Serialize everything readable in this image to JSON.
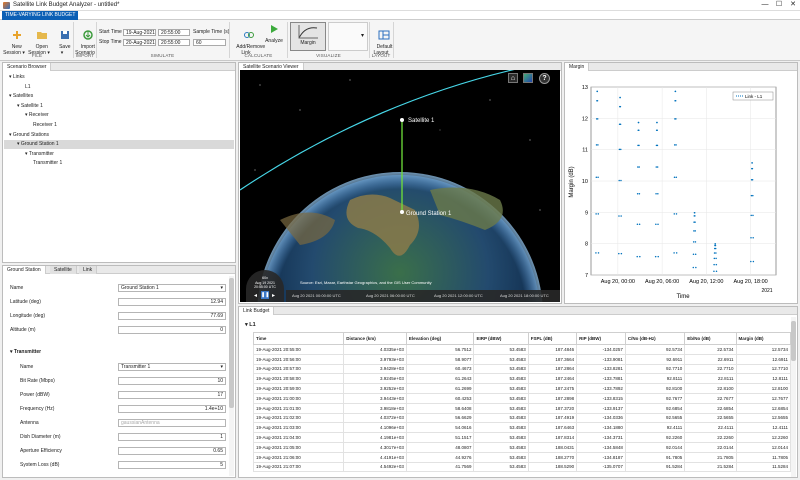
{
  "window": {
    "title": "Satellite Link Budget Analyzer - untitled*",
    "min": "—",
    "max": "☐",
    "close": "✕"
  },
  "toolstrip_tab": "TIME-VARYING LINK BUDGET",
  "toolbar": {
    "new_session": "New\nSession ▾",
    "open_session": "Open\nSession ▾",
    "save": "Save\n▾",
    "import": "Import\nScenario",
    "start_time_label": "Start Time",
    "start_date": "19-Aug-2021",
    "start_clock": "20:55:00",
    "stop_time_label": "Stop Time",
    "stop_date": "20-Aug-2021",
    "stop_clock": "20:55:00",
    "sample_time_label": "Sample Time (s)",
    "sample_time": "60",
    "add_remove_link": "Add/Remove\nLink",
    "analyze": "Analyze",
    "visualize_margin": "Margin",
    "default_layout": "Default\nLayout",
    "sections": {
      "file": "FILE",
      "import": "IMPORT",
      "simulate": "SIMULATE",
      "calculate": "CALCULATE",
      "visualize": "VISUALIZE",
      "layout": "LAYOUT"
    }
  },
  "scenario_browser": {
    "title": "Scenario Browser",
    "tree": [
      {
        "label": "Links",
        "indent": 0,
        "arrow": "▾"
      },
      {
        "label": "L1",
        "indent": 2,
        "arrow": ""
      },
      {
        "label": "Satellites",
        "indent": 0,
        "arrow": "▾"
      },
      {
        "label": "Satellite 1",
        "indent": 1,
        "arrow": "▾"
      },
      {
        "label": "Receiver",
        "indent": 2,
        "arrow": "▾"
      },
      {
        "label": "Receiver 1",
        "indent": 3,
        "arrow": ""
      },
      {
        "label": "Ground Stations",
        "indent": 0,
        "arrow": "▾"
      },
      {
        "label": "Ground Station 1",
        "indent": 1,
        "arrow": "▾",
        "selected": true
      },
      {
        "label": "Transmitter",
        "indent": 2,
        "arrow": "▾"
      },
      {
        "label": "Transmitter 1",
        "indent": 3,
        "arrow": ""
      }
    ]
  },
  "props": {
    "tabs": [
      "Ground Station",
      "Satellite",
      "Link"
    ],
    "name_label": "Name",
    "name_value": "Ground Station 1",
    "lat_label": "Latitude (deg)",
    "lat_value": "12.94",
    "lon_label": "Longitude (deg)",
    "lon_value": "77.69",
    "alt_label": "Altitude (m)",
    "alt_value": "0",
    "tx_header": "▾ Transmitter",
    "tx_name_label": "Name",
    "tx_name_value": "Transmitter 1",
    "bitrate_label": "Bit Rate (Mbps)",
    "bitrate_value": "10",
    "power_label": "Power (dBW)",
    "power_value": "17",
    "freq_label": "Frequency (Hz)",
    "freq_value": "1.4e+10",
    "antenna_label": "Antenna",
    "antenna_placeholder": "gaussianAntenna",
    "dish_label": "Dish Diameter (m)",
    "dish_value": "1",
    "eff_label": "Aperture Efficiency",
    "eff_value": "0.65",
    "loss_label": "System Loss (dB)",
    "loss_value": "5"
  },
  "viewer": {
    "title": "Satellite Scenario Viewer",
    "satellite_label": "Satellite 1",
    "ground_label": "Ground Station 1",
    "attribution": "Source: Esri, Maxar, Earthstar Geographics, and the GIS User Community",
    "timeline": [
      "Aug 20 2021 00:00:00 UTC",
      "Aug 20 2021 06:00:00 UTC",
      "Aug 20 2021 12:00:00 UTC",
      "Aug 20 2021 18:00:00 UTC"
    ],
    "clock_date": "Aug 19 2021",
    "clock_time": "20:55:00 UTC",
    "speed": "60x"
  },
  "margin_panel": {
    "title": "Margin"
  },
  "chart_data": {
    "type": "scatter",
    "ylabel": "Margin (dB)",
    "xlabel": "Time",
    "ylim": [
      7,
      13
    ],
    "yticks": [
      "13",
      "12",
      "11",
      "10",
      "9",
      "8",
      "7"
    ],
    "xticks": [
      "Aug 20, 00:00",
      "Aug 20, 06:00",
      "Aug 20, 12:00",
      "Aug 20, 18:00"
    ],
    "xyear": "2021",
    "legend": "Link - L1",
    "legend_position": "top-right",
    "color": "#0072bd",
    "passes": [
      {
        "t": 0.2,
        "peak": 12.9
      },
      {
        "t": 3.3,
        "peak": 12.7
      },
      {
        "t": 5.8,
        "peak": 11.9
      },
      {
        "t": 8.3,
        "peak": 11.9
      },
      {
        "t": 10.8,
        "peak": 12.9
      },
      {
        "t": 13.4,
        "peak": 9.0
      },
      {
        "t": 16.2,
        "peak": 8.0
      },
      {
        "t": 21.2,
        "peak": 10.6
      }
    ]
  },
  "link_budget": {
    "title": "Link Budget",
    "section": "▾ L1",
    "columns": [
      "Time",
      "Distance (km)",
      "Elevation (deg)",
      "EIRP (dBW)",
      "FSPL (dB)",
      "RIP (dBW)",
      "C/No (dB-Hz)",
      "Eb/No (dB)",
      "Margin (dB)"
    ],
    "rows": [
      [
        "19-Aug-2021 20:55:00",
        "4.0335e+03",
        "56.7512",
        "53.4583",
        "187.4846",
        "-134.0257",
        "92.5734",
        "22.5734",
        "12.5734"
      ],
      [
        "19-Aug-2021 20:56:00",
        "3.9793e+03",
        "58.9077",
        "53.4583",
        "187.3664",
        "-133.9081",
        "92.6911",
        "22.6911",
        "12.6911"
      ],
      [
        "19-Aug-2021 20:57:00",
        "3.9428e+03",
        "60.4673",
        "53.4583",
        "187.2864",
        "-133.8281",
        "92.7710",
        "22.7710",
        "12.7710"
      ],
      [
        "19-Aug-2021 20:58:00",
        "3.9245e+03",
        "61.2643",
        "53.4583",
        "187.2464",
        "-133.7881",
        "92.8111",
        "22.8111",
        "12.8111"
      ],
      [
        "19-Aug-2021 20:59:00",
        "3.9252e+03",
        "61.2699",
        "53.4583",
        "187.2475",
        "-133.7892",
        "92.8100",
        "22.8100",
        "12.8100"
      ],
      [
        "19-Aug-2021 21:00:00",
        "3.9443e+03",
        "60.4253",
        "53.4583",
        "187.2898",
        "-133.8315",
        "92.7677",
        "22.7677",
        "12.7677"
      ],
      [
        "19-Aug-2021 21:01:00",
        "3.9818e+03",
        "58.6408",
        "53.4583",
        "187.3720",
        "-133.9137",
        "92.6854",
        "22.6854",
        "12.6854"
      ],
      [
        "19-Aug-2021 21:02:00",
        "4.0372e+03",
        "56.6629",
        "53.4583",
        "187.4919",
        "-134.0336",
        "92.5655",
        "22.5655",
        "12.5655"
      ],
      [
        "19-Aug-2021 21:03:00",
        "4.1096e+03",
        "54.0616",
        "53.4583",
        "187.6463",
        "-134.1880",
        "92.4111",
        "22.4111",
        "12.4111"
      ],
      [
        "19-Aug-2021 21:04:00",
        "4.1981e+03",
        "51.1517",
        "53.4583",
        "187.8314",
        "-134.3731",
        "92.2260",
        "22.2260",
        "12.2260"
      ],
      [
        "19-Aug-2021 21:05:00",
        "4.3017e+03",
        "48.0807",
        "53.4583",
        "188.0431",
        "-134.5848",
        "92.0144",
        "22.0144",
        "12.0144"
      ],
      [
        "19-Aug-2021 21:06:00",
        "4.4191e+03",
        "44.9276",
        "53.4583",
        "188.2770",
        "-134.8187",
        "91.7805",
        "21.7805",
        "11.7805"
      ],
      [
        "19-Aug-2021 21:07:00",
        "4.5492e+03",
        "41.7569",
        "53.4583",
        "188.5290",
        "-135.0707",
        "91.5284",
        "21.5284",
        "11.5284"
      ]
    ]
  }
}
